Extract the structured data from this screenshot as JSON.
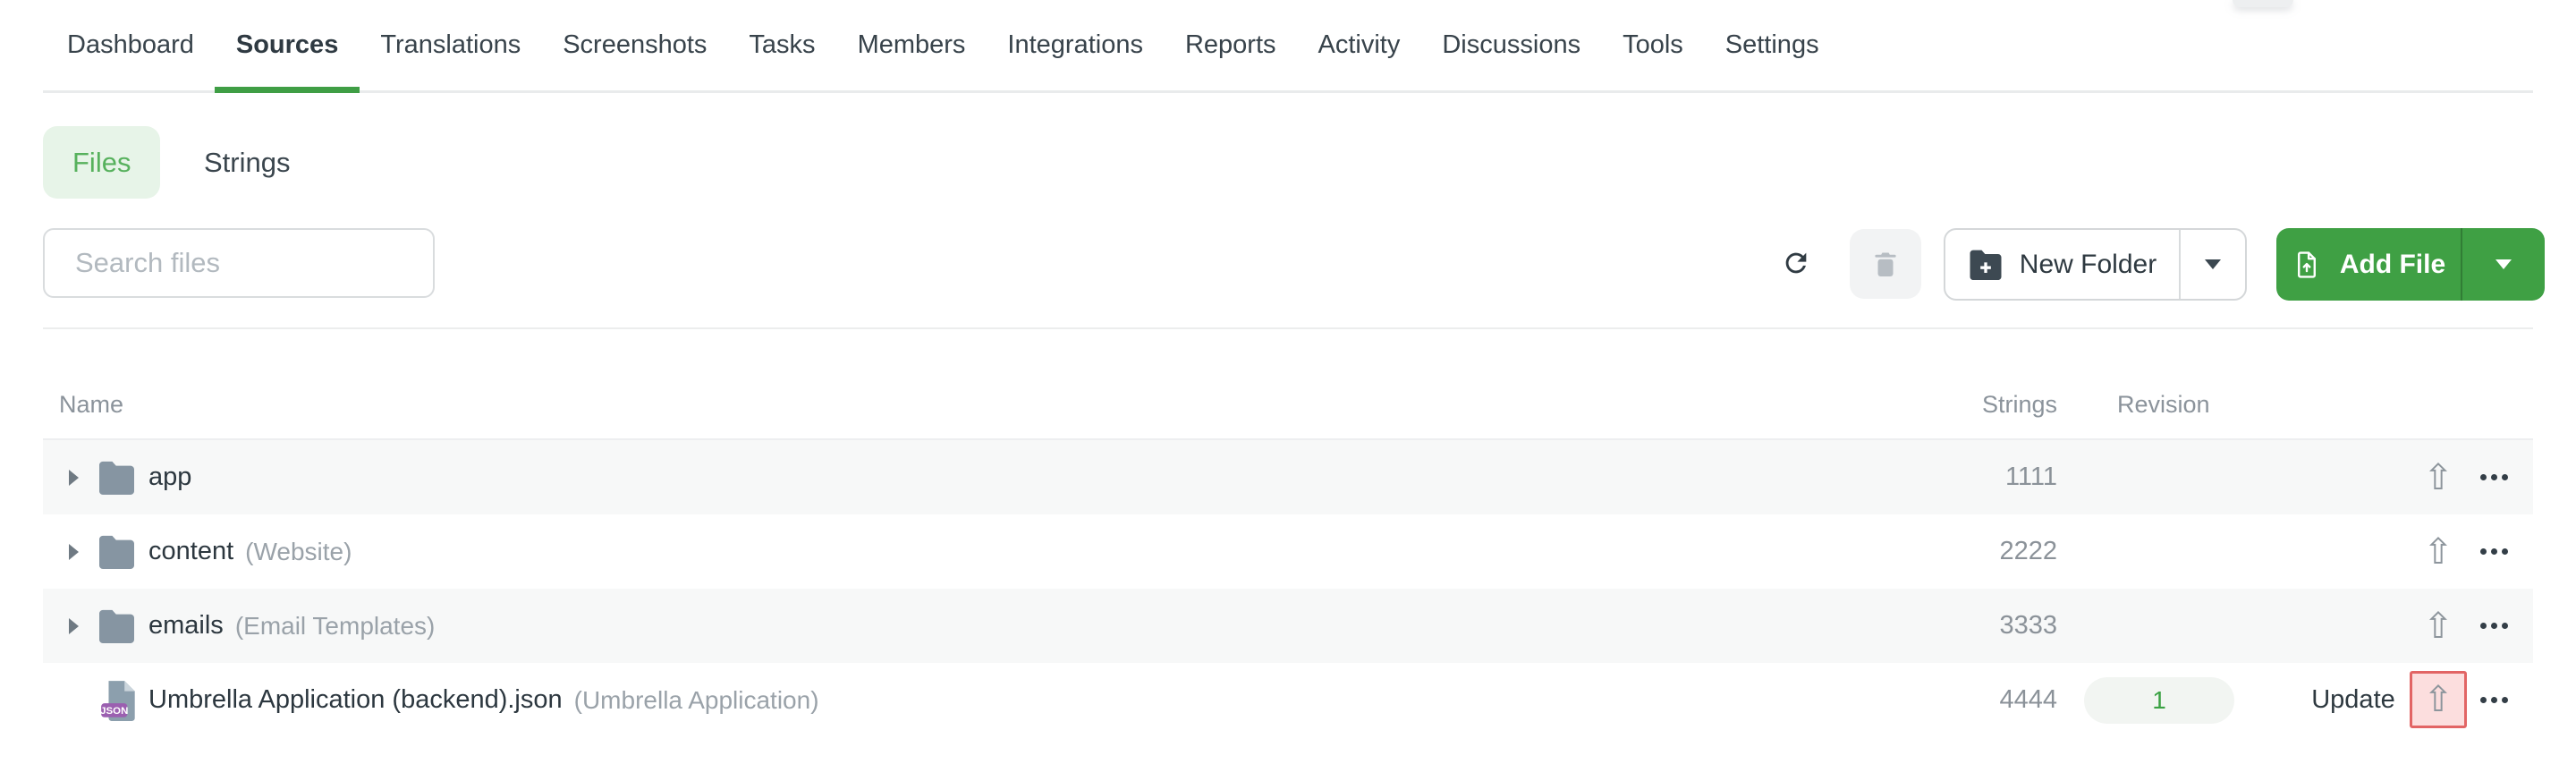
{
  "nav": {
    "items": [
      "Dashboard",
      "Sources",
      "Translations",
      "Screenshots",
      "Tasks",
      "Members",
      "Integrations",
      "Reports",
      "Activity",
      "Discussions",
      "Tools",
      "Settings"
    ],
    "active_item": "Sources"
  },
  "tabs": {
    "files_label": "Files",
    "strings_label": "Strings",
    "active_tab": "Files"
  },
  "search": {
    "placeholder": "Search files"
  },
  "toolbar": {
    "new_folder_label": "New Folder",
    "add_file_label": "Add File"
  },
  "table": {
    "headers": {
      "name": "Name",
      "strings": "Strings",
      "revision": "Revision"
    },
    "rows": [
      {
        "type": "folder",
        "name": "app",
        "secondary": "",
        "strings": "1111"
      },
      {
        "type": "folder",
        "name": "content",
        "secondary": "(Website)",
        "strings": "2222"
      },
      {
        "type": "folder",
        "name": "emails",
        "secondary": "(Email Templates)",
        "strings": "3333"
      },
      {
        "type": "file",
        "file_type_badge": "JSON",
        "name": "Umbrella Application (backend).json",
        "secondary": "(Umbrella Application)",
        "strings": "4444",
        "revision": "1",
        "update_label": "Update",
        "highlighted": true
      }
    ]
  },
  "icons": {
    "upload": "⇧"
  },
  "colors": {
    "accent_green": "#3fa044",
    "nav_underline_green": "#3f9e45",
    "files_pill_bg": "#e7f4e8",
    "files_pill_text": "#57b15d",
    "revision_green": "#3ba244",
    "highlight_border": "#e26565",
    "highlight_bg": "#fcdede",
    "row_alt_bg": "#f7f8f8",
    "json_badge_purple": "#9b5fb0"
  }
}
